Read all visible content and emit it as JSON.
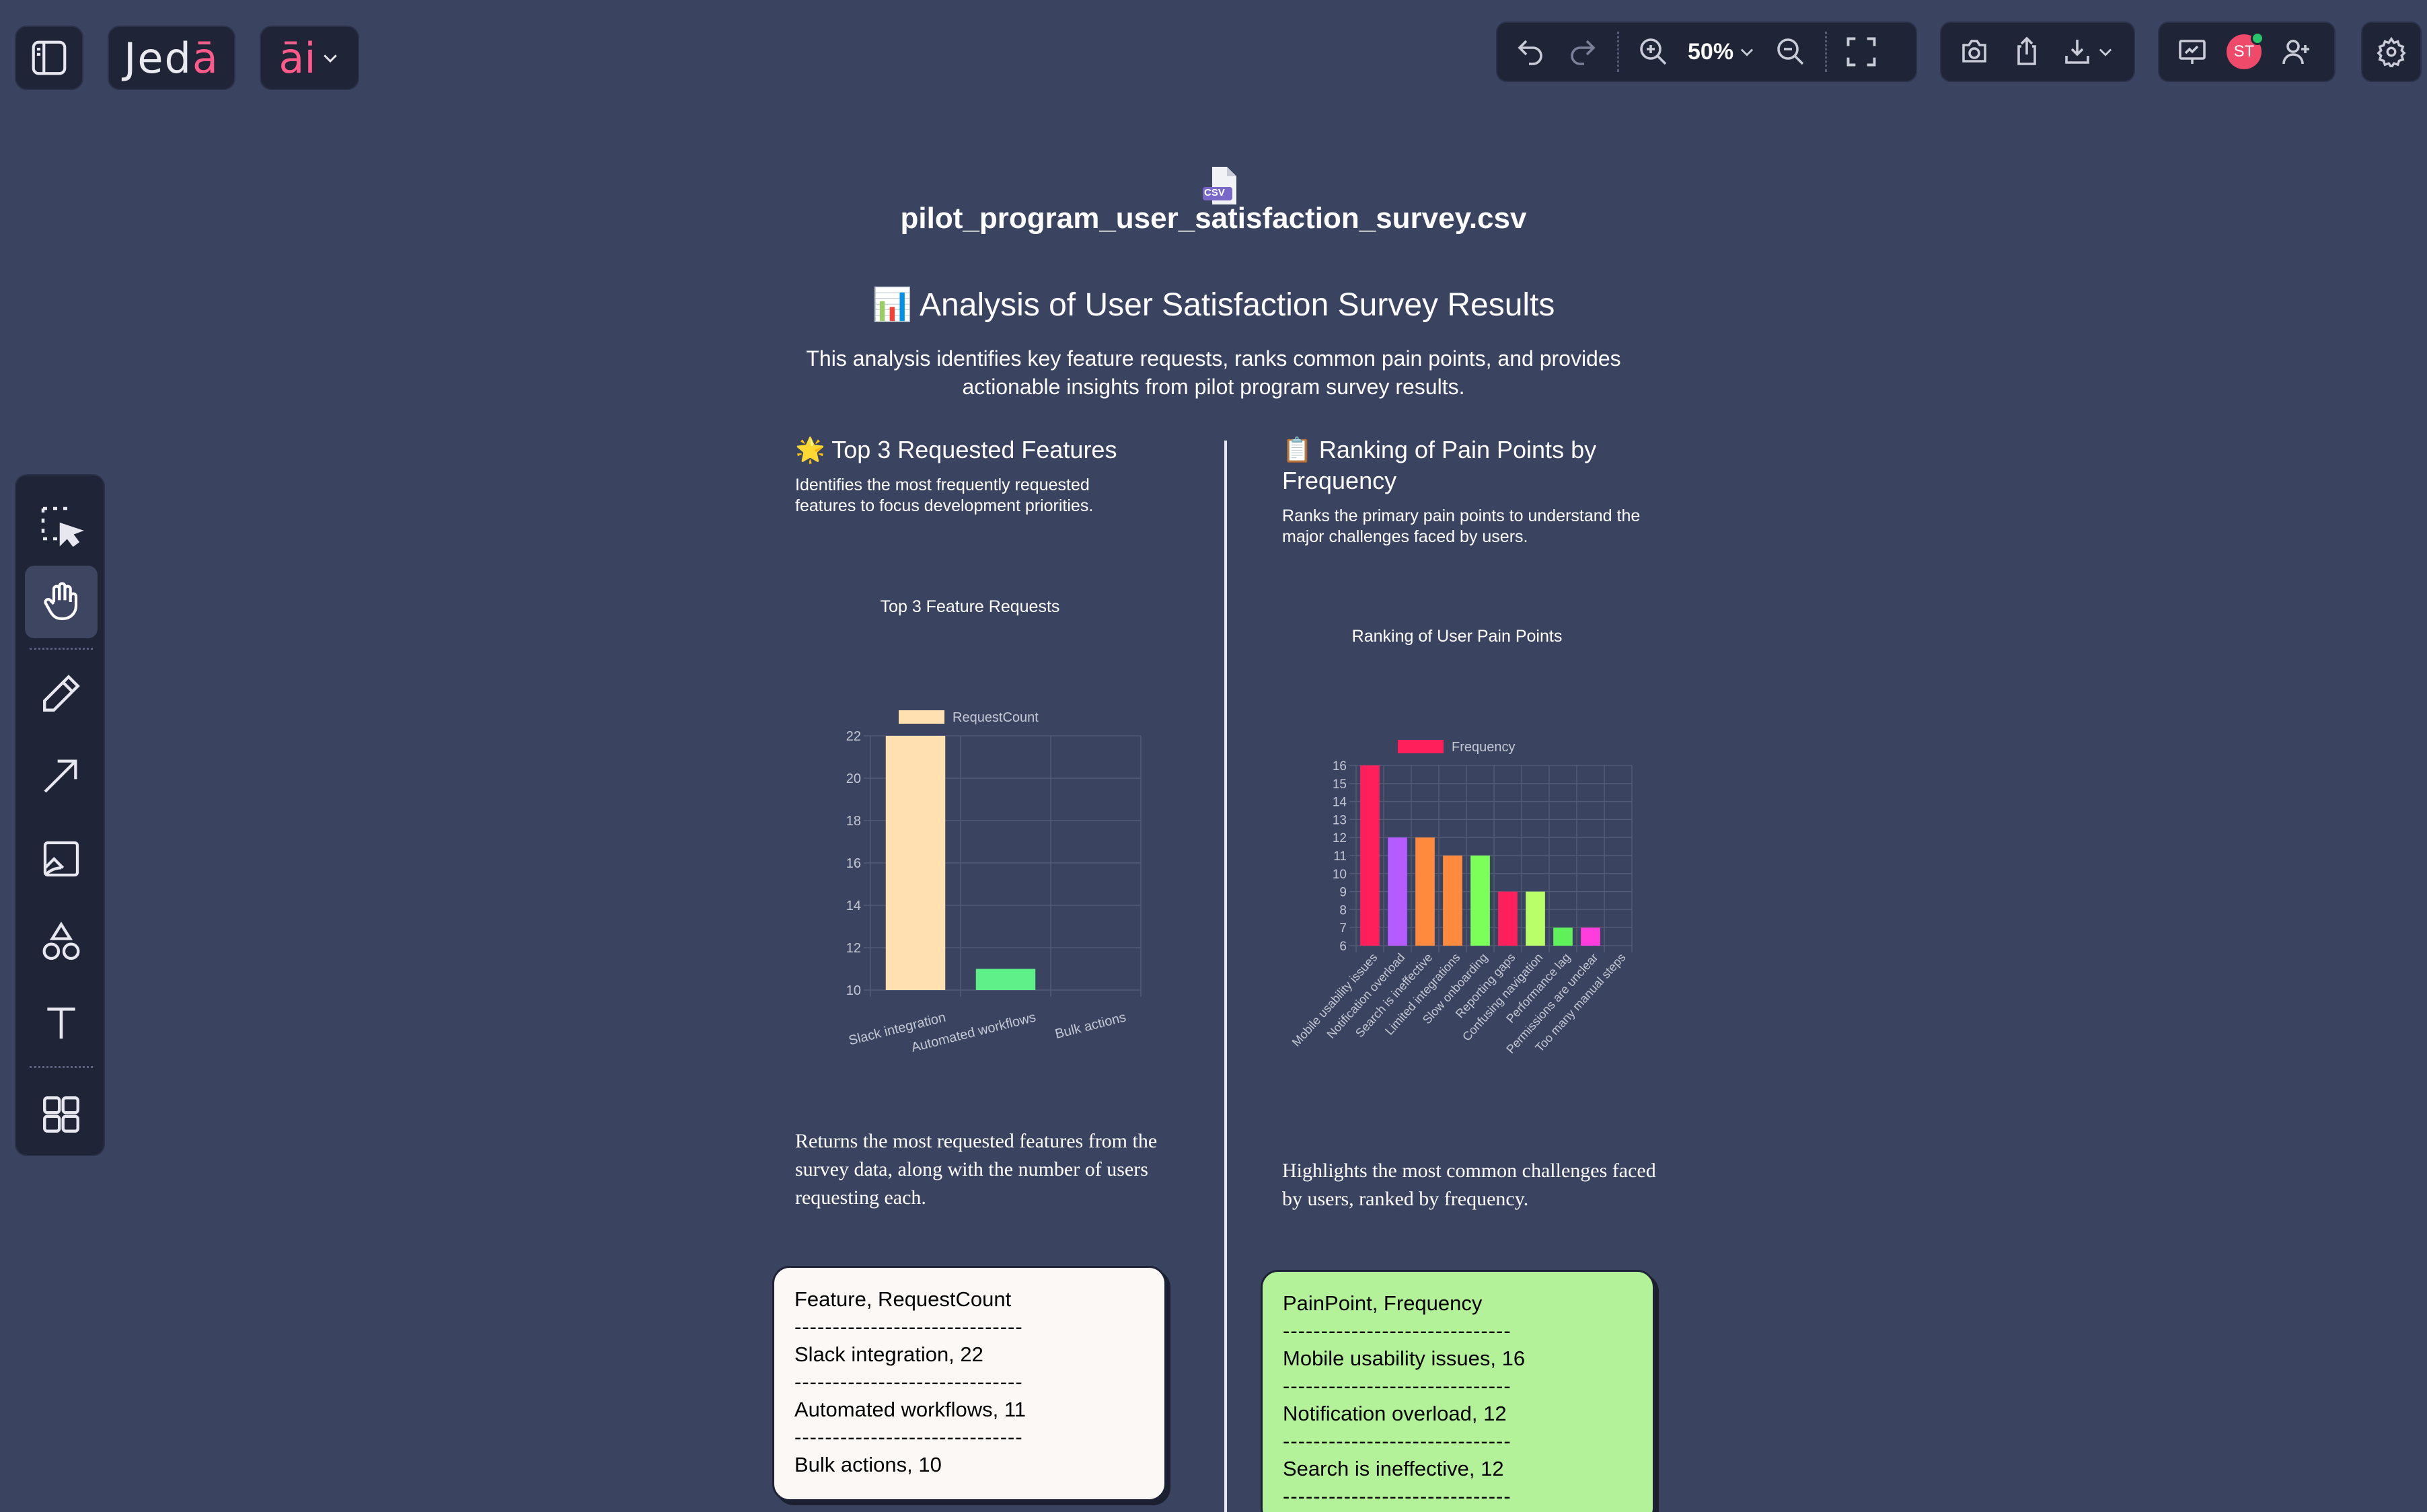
{
  "app": {
    "logo_main": "Jed",
    "logo_accent": "ā",
    "ai_label": "āi",
    "zoom": "50%",
    "avatar_initials": "ST"
  },
  "document": {
    "file_label": "CSV",
    "file_name": "pilot_program_user_satisfaction_survey.csv",
    "title_emoji": "📊",
    "title": "Analysis of User Satisfaction Survey Results",
    "subtitle": "This analysis identifies key feature requests, ranks common pain points, and provides actionable insights from pilot program survey results."
  },
  "left_section": {
    "heading_emoji": "🌟",
    "heading": "Top 3 Requested Features",
    "description": "Identifies the most frequently requested features to focus development priorities.",
    "note": "Returns the most requested features from the survey data, along with the number of users requesting each.",
    "card_lines": [
      "Feature, RequestCount",
      "Slack integration, 22",
      "Automated workflows, 11",
      "Bulk actions, 10"
    ],
    "card_divider": "------------------------------"
  },
  "right_section": {
    "heading_emoji": "📋",
    "heading": "Ranking of Pain Points by Frequency",
    "description": "Ranks the primary pain points to understand the major challenges faced by users.",
    "note": "Highlights the most common challenges faced by users, ranked by frequency.",
    "card_lines": [
      "PainPoint, Frequency",
      "Mobile usability issues, 16",
      "Notification overload, 12",
      "Search is ineffective, 12"
    ],
    "card_divider": "------------------------------"
  },
  "chart_data": [
    {
      "type": "bar",
      "title": "Top 3 Feature Requests",
      "categories": [
        "Slack integration",
        "Automated workflows",
        "Bulk actions"
      ],
      "series": [
        {
          "name": "RequestCount",
          "values": [
            22,
            11,
            10
          ]
        }
      ],
      "colors": [
        "#ffe0b0",
        "#5ff08a",
        "#ff8a9a"
      ],
      "legend_color": "#ffe0b0",
      "ylim": [
        10,
        22
      ],
      "yticks": [
        10,
        12,
        14,
        16,
        18,
        20,
        22
      ],
      "grid": true,
      "legend": "top"
    },
    {
      "type": "bar",
      "title": "Ranking of User Pain Points",
      "categories": [
        "Mobile usability issues",
        "Notification overload",
        "Search is ineffective",
        "Limited integrations",
        "Slow onboarding",
        "Reporting gaps",
        "Confusing navigation",
        "Performance lag",
        "Permissions are unclear",
        "Too many manual steps"
      ],
      "series": [
        {
          "name": "Frequency",
          "values": [
            16,
            12,
            12,
            11,
            11,
            9,
            9,
            7,
            7,
            6
          ]
        }
      ],
      "colors": [
        "#ff1f5a",
        "#b45cff",
        "#ff8a3d",
        "#ff8a3d",
        "#7dff5a",
        "#ff1f5a",
        "#b8ff6a",
        "#5ff05a",
        "#ff3ddc",
        "#ff1f5a"
      ],
      "legend_color": "#ff1f5a",
      "ylim": [
        6,
        16
      ],
      "yticks": [
        6,
        7,
        8,
        9,
        10,
        11,
        12,
        13,
        14,
        15,
        16
      ],
      "grid": true,
      "legend": "top"
    }
  ]
}
